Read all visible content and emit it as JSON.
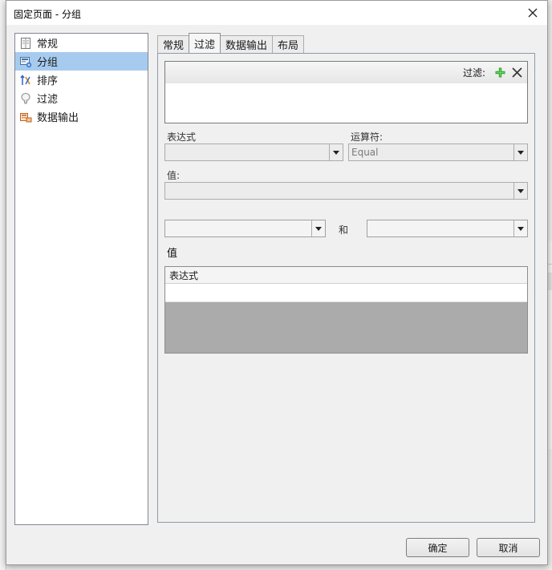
{
  "window": {
    "title": "固定页面 - 分组"
  },
  "tree": {
    "items": [
      {
        "label": "常规",
        "icon": "document-icon",
        "selected": false
      },
      {
        "label": "分组",
        "icon": "group-icon",
        "selected": true
      },
      {
        "label": "排序",
        "icon": "sort-icon",
        "selected": false
      },
      {
        "label": "过滤",
        "icon": "filter-icon",
        "selected": false
      },
      {
        "label": "数据输出",
        "icon": "data-output-icon",
        "selected": false
      }
    ]
  },
  "tabs": [
    {
      "label": "常规",
      "active": false
    },
    {
      "label": "过滤",
      "active": true
    },
    {
      "label": "数据输出",
      "active": false
    },
    {
      "label": "布局",
      "active": false
    }
  ],
  "filter": {
    "header_label": "过滤:",
    "add_icon": "plus-icon",
    "remove_icon": "close-icon",
    "add_color": "#2fa82f"
  },
  "fields": {
    "expression_label": "表达式",
    "expression_value": "",
    "operator_label": "运算符:",
    "operator_value": "Equal",
    "value_label": "值:",
    "value_value": "",
    "range_from": "",
    "range_and": "和",
    "range_to": "",
    "values_label": "值"
  },
  "expr_table": {
    "column_header": "表达式"
  },
  "buttons": {
    "ok": "确定",
    "cancel": "取消"
  },
  "colors": {
    "selection": "#a7cbef",
    "dialog_bg": "#f0f0f0"
  }
}
